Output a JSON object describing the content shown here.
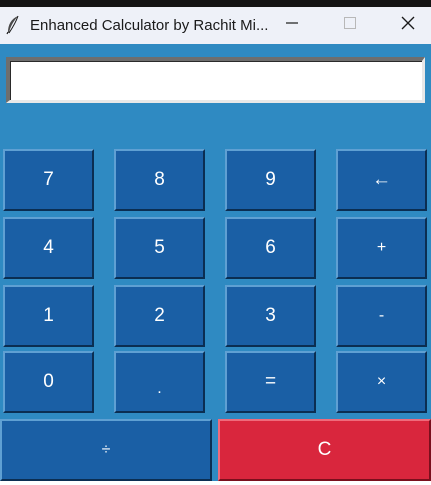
{
  "window": {
    "title": "Enhanced Calculator by Rachit Mi...",
    "icon": "feather-icon",
    "controls": {
      "minimize": "minimize-icon",
      "maximize": "maximize-icon",
      "close": "close-icon"
    }
  },
  "display": {
    "value": ""
  },
  "keys": {
    "row1": [
      "7",
      "8",
      "9",
      "←"
    ],
    "row2": [
      "4",
      "5",
      "6",
      "+"
    ],
    "row3": [
      "1",
      "2",
      "3",
      "-"
    ],
    "row4": [
      "0",
      ".",
      "=",
      "×"
    ],
    "divide": "÷",
    "clear": "C"
  },
  "colors": {
    "background": "#2f8ac2",
    "key": "#1a5fa5",
    "clear_key": "#d9263d",
    "titlebar": "#eef1f8"
  }
}
